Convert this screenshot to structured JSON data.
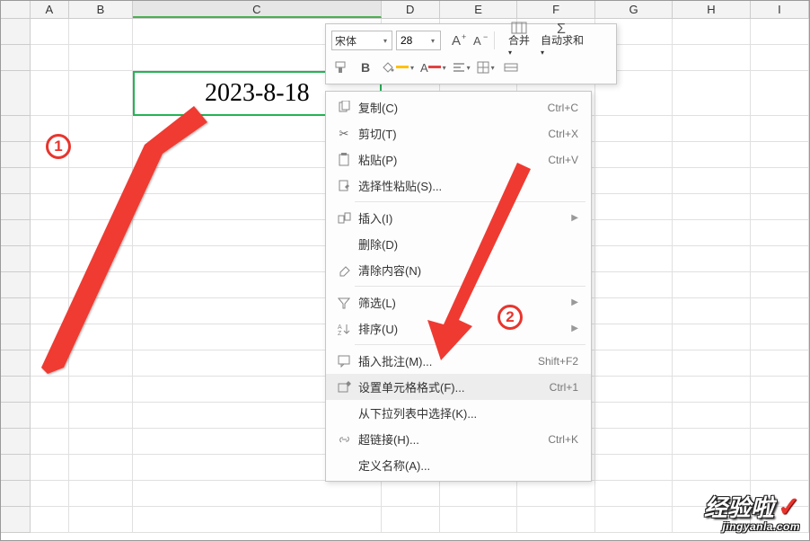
{
  "columns": [
    "A",
    "B",
    "C",
    "D",
    "E",
    "F",
    "G",
    "H",
    "I"
  ],
  "active_cell": {
    "value": "2023-8-18",
    "font": "宋体",
    "size": "28"
  },
  "mini_toolbar": {
    "grow_font": "A⁺",
    "shrink_font": "A⁻",
    "bold": "B",
    "merge_label": "合并",
    "merge_arrow": "▾",
    "autosum_label": "自动求和",
    "autosum_arrow": "▾"
  },
  "context_menu": {
    "copy": {
      "label": "复制(C)",
      "shortcut": "Ctrl+C"
    },
    "cut": {
      "label": "剪切(T)",
      "shortcut": "Ctrl+X"
    },
    "paste": {
      "label": "粘贴(P)",
      "shortcut": "Ctrl+V"
    },
    "paste_special": {
      "label": "选择性粘贴(S)..."
    },
    "insert": {
      "label": "插入(I)"
    },
    "delete": {
      "label": "删除(D)"
    },
    "clear": {
      "label": "清除内容(N)"
    },
    "filter": {
      "label": "筛选(L)"
    },
    "sort": {
      "label": "排序(U)"
    },
    "comment": {
      "label": "插入批注(M)...",
      "shortcut": "Shift+F2"
    },
    "format_cells": {
      "label": "设置单元格格式(F)...",
      "shortcut": "Ctrl+1"
    },
    "pick_list": {
      "label": "从下拉列表中选择(K)..."
    },
    "hyperlink": {
      "label": "超链接(H)...",
      "shortcut": "Ctrl+K"
    },
    "define_name": {
      "label": "定义名称(A)..."
    }
  },
  "callouts": {
    "one": "1",
    "two": "2"
  },
  "watermark": {
    "line1": "经验啦",
    "check": "✓",
    "line2": "jingyanla.com"
  }
}
